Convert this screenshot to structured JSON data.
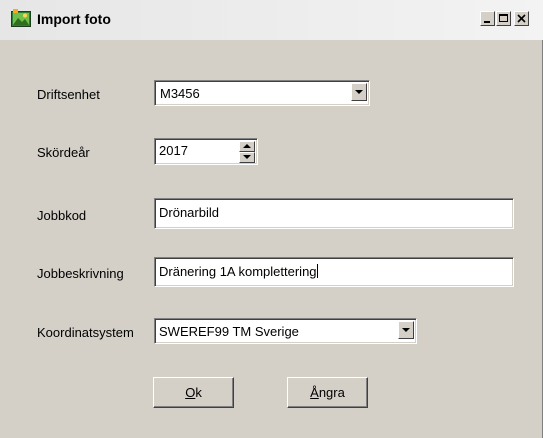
{
  "window": {
    "title": "Import foto"
  },
  "caption_buttons": {
    "minimize": "minimize-icon",
    "maximize": "maximize-icon",
    "close": "close-icon"
  },
  "form": {
    "driftsenhet": {
      "label": "Driftsenhet",
      "value": "M3456"
    },
    "skordear": {
      "label": "Skördeår",
      "value": "2017"
    },
    "jobbkod": {
      "label": "Jobbkod",
      "value": "Drönarbild"
    },
    "jobbeskrivning": {
      "label": "Jobbeskrivning",
      "value": "Dränering 1A komplettering"
    },
    "koordinatsystem": {
      "label": "Koordinatsystem",
      "value": "SWEREF99 TM Sverige"
    }
  },
  "buttons": {
    "ok": {
      "accel": "O",
      "rest": "k"
    },
    "angra": {
      "accel": "Å",
      "rest": "ngra"
    }
  },
  "colors": {
    "face": "#d4d0c8",
    "titlebar": "#ececec"
  }
}
